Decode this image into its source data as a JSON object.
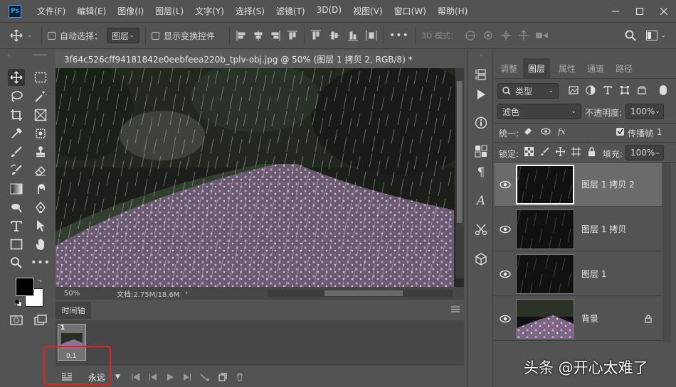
{
  "app": {
    "logo": "Ps"
  },
  "menu": [
    "文件(F)",
    "编辑(E)",
    "图像(I)",
    "图层(L)",
    "文字(Y)",
    "选择(S)",
    "滤镜(T)",
    "3D(D)",
    "视图(V)",
    "窗口(W)",
    "帮助(H)"
  ],
  "options": {
    "auto_select_label": "自动选择：",
    "auto_select_value": "图层",
    "show_transform_label": "显示变换控件",
    "mode_3d_label": "3D 模式：",
    "more": "•••"
  },
  "document": {
    "tab_title": "3f64c526cff94181842e0eebfeea220b_tplv-obj.jpg @ 50% (图层 1 拷贝 2, RGB/8) *",
    "zoom": "50%",
    "doc_size": "文档:2.75M/18.6M"
  },
  "timeline": {
    "tab_label": "时间轴",
    "frame_number": "1",
    "frame_delay": "0.1",
    "loop_value": "永远"
  },
  "panels": {
    "tabs": [
      "调整",
      "图层",
      "属性",
      "通道",
      "路径"
    ],
    "active_tab": "图层",
    "filter_label": "类型",
    "blend_mode": "滤色",
    "opacity_label": "不透明度:",
    "opacity_value": "100%",
    "unify_label": "统一:",
    "propagate_label": "传播帧",
    "propagate_value": "1",
    "lock_label": "锁定:",
    "fill_label": "填充:",
    "fill_value": "100%"
  },
  "layers": [
    {
      "name": "图层 1 拷贝 2",
      "selected": true
    },
    {
      "name": "图层 1 拷贝",
      "selected": false
    },
    {
      "name": "图层 1",
      "selected": false
    },
    {
      "name": "背景",
      "selected": false,
      "locked": true
    }
  ],
  "watermark": "头条 @开心太难了",
  "colors": {
    "highlight_box": "#e62020",
    "ps_blue": "#31a8ff"
  }
}
